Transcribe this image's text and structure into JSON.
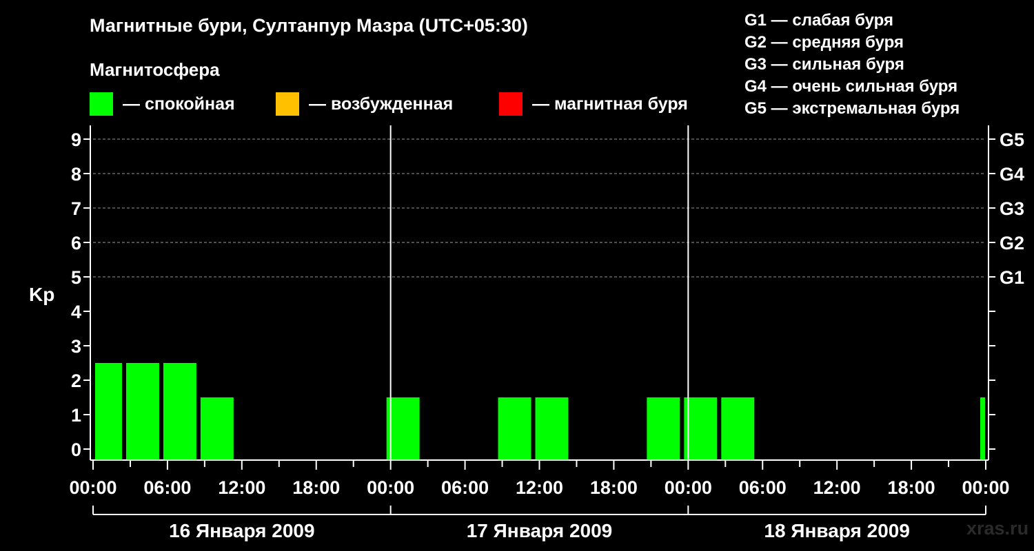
{
  "header": {
    "title": "Магнитные бури, Султанпур Мазра (UTC+05:30)",
    "subtitle": "Магнитосфера"
  },
  "legend": [
    {
      "label": "— спокойная",
      "color": "#00ff00"
    },
    {
      "label": "— возбужденная",
      "color": "#ffc000"
    },
    {
      "label": "— магнитная буря",
      "color": "#ff0000"
    }
  ],
  "storm_scale": [
    "G1 — слабая буря",
    "G2 — средняя буря",
    "G3 — сильная буря",
    "G4 — очень сильная буря",
    "G5 — экстремальная буря"
  ],
  "watermark": "xras.ru",
  "chart_data": {
    "type": "bar",
    "ylabel": "Kp",
    "ylim": [
      0,
      9
    ],
    "yticks": [
      "0",
      "1",
      "2",
      "3",
      "4",
      "5",
      "6",
      "7",
      "8",
      "9"
    ],
    "right_ticks": [
      {
        "level": 5,
        "label": "G1"
      },
      {
        "level": 6,
        "label": "G2"
      },
      {
        "level": 7,
        "label": "G3"
      },
      {
        "level": 8,
        "label": "G4"
      },
      {
        "level": 9,
        "label": "G5"
      }
    ],
    "grid": "dashed at Kp 5–9",
    "xticks": [
      "00:00",
      "06:00",
      "12:00",
      "18:00",
      "00:00",
      "06:00",
      "12:00",
      "18:00",
      "00:00",
      "06:00",
      "12:00",
      "18:00",
      "00:00"
    ],
    "days": [
      "16 Января 2009",
      "17 Января 2009",
      "18 Января 2009"
    ],
    "bar_color": "#00ff00",
    "bars": [
      {
        "start": "16.01 00:00",
        "end": "16.01 02:30",
        "kp": 2
      },
      {
        "start": "16.01 02:30",
        "end": "16.01 05:30",
        "kp": 2
      },
      {
        "start": "16.01 05:30",
        "end": "16.01 08:30",
        "kp": 2
      },
      {
        "start": "16.01 08:30",
        "end": "16.01 11:30",
        "kp": 1
      },
      {
        "start": "16.01 23:30",
        "end": "17.01 02:30",
        "kp": 1
      },
      {
        "start": "17.01 08:30",
        "end": "17.01 11:30",
        "kp": 1
      },
      {
        "start": "17.01 11:30",
        "end": "17.01 14:30",
        "kp": 1
      },
      {
        "start": "17.01 20:30",
        "end": "17.01 23:30",
        "kp": 1
      },
      {
        "start": "17.01 23:30",
        "end": "18.01 02:30",
        "kp": 1
      },
      {
        "start": "18.01 02:30",
        "end": "18.01 05:30",
        "kp": 1
      },
      {
        "start": "18.01 23:30",
        "end": "19.01 00:00",
        "kp": 1
      }
    ]
  }
}
